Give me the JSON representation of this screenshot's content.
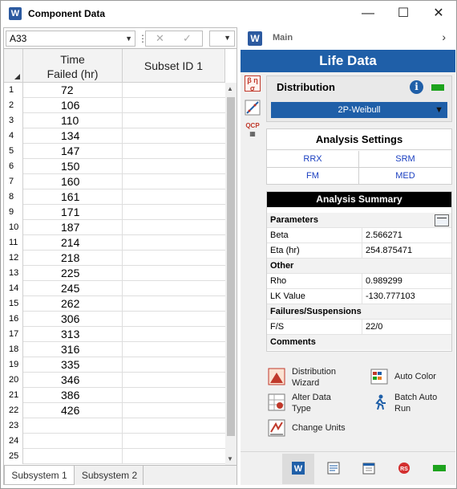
{
  "window": {
    "title": "Component Data",
    "app_icon": "W",
    "controls": {
      "minimize": "—",
      "maximize": "☐",
      "close": "✕"
    }
  },
  "formula_bar": {
    "cell_ref": "A33",
    "cancel": "✕",
    "confirm": "✓"
  },
  "sheet": {
    "columns": [
      "Time Failed (hr)",
      "Subset ID 1"
    ],
    "column_a_lines": [
      "Time",
      "Failed (hr)"
    ],
    "rows": [
      {
        "n": "1",
        "a": "72"
      },
      {
        "n": "2",
        "a": "106"
      },
      {
        "n": "3",
        "a": "110"
      },
      {
        "n": "4",
        "a": "134"
      },
      {
        "n": "5",
        "a": "147"
      },
      {
        "n": "6",
        "a": "150"
      },
      {
        "n": "7",
        "a": "160"
      },
      {
        "n": "8",
        "a": "161"
      },
      {
        "n": "9",
        "a": "171"
      },
      {
        "n": "10",
        "a": "187"
      },
      {
        "n": "11",
        "a": "214"
      },
      {
        "n": "12",
        "a": "218"
      },
      {
        "n": "13",
        "a": "225"
      },
      {
        "n": "14",
        "a": "245"
      },
      {
        "n": "15",
        "a": "262"
      },
      {
        "n": "16",
        "a": "306"
      },
      {
        "n": "17",
        "a": "313"
      },
      {
        "n": "18",
        "a": "316"
      },
      {
        "n": "19",
        "a": "335"
      },
      {
        "n": "20",
        "a": "346"
      },
      {
        "n": "21",
        "a": "386"
      },
      {
        "n": "22",
        "a": "426"
      },
      {
        "n": "23",
        "a": ""
      },
      {
        "n": "24",
        "a": ""
      },
      {
        "n": "25",
        "a": ""
      }
    ],
    "tabs": [
      "Subsystem 1",
      "Subsystem 2"
    ],
    "active_tab": "Subsystem 1"
  },
  "right": {
    "main_label": "Main",
    "header": "Life Data",
    "side_icons": [
      "β η σ",
      "plot",
      "QCP"
    ],
    "distribution": {
      "label": "Distribution",
      "info_icon": "i",
      "selected": "2P-Weibull",
      "status_color": "#1da31d"
    },
    "analysis_settings": {
      "title": "Analysis Settings",
      "options": [
        "RRX",
        "SRM",
        "FM",
        "MED"
      ]
    },
    "analysis_summary": {
      "title": "Analysis Summary",
      "sections": [
        {
          "label": "Parameters",
          "rows": [
            [
              "Beta",
              "2.566271"
            ],
            [
              "Eta (hr)",
              "254.875471"
            ]
          ]
        },
        {
          "label": "Other",
          "rows": [
            [
              "Rho",
              "0.989299"
            ],
            [
              "LK Value",
              "-130.777103"
            ]
          ]
        },
        {
          "label": "Failures/Suspensions",
          "rows": [
            [
              "F/S",
              "22/0"
            ]
          ]
        },
        {
          "label": "Comments",
          "rows": []
        }
      ]
    },
    "actions": {
      "distribution_wizard": [
        "Distribution",
        "Wizard"
      ],
      "auto_color": "Auto Color",
      "alter_data_type": [
        "Alter Data",
        "Type"
      ],
      "batch_auto_run": [
        "Batch Auto",
        "Run"
      ],
      "change_units": "Change Units"
    },
    "bottom_icons": [
      "weibull-folio-icon",
      "report-icon",
      "calendar-icon",
      "rs-icon",
      "status-icon"
    ]
  },
  "colors": {
    "brand_blue": "#1f5fa8",
    "accent_green": "#1da31d",
    "link_blue": "#1a3fc0"
  }
}
